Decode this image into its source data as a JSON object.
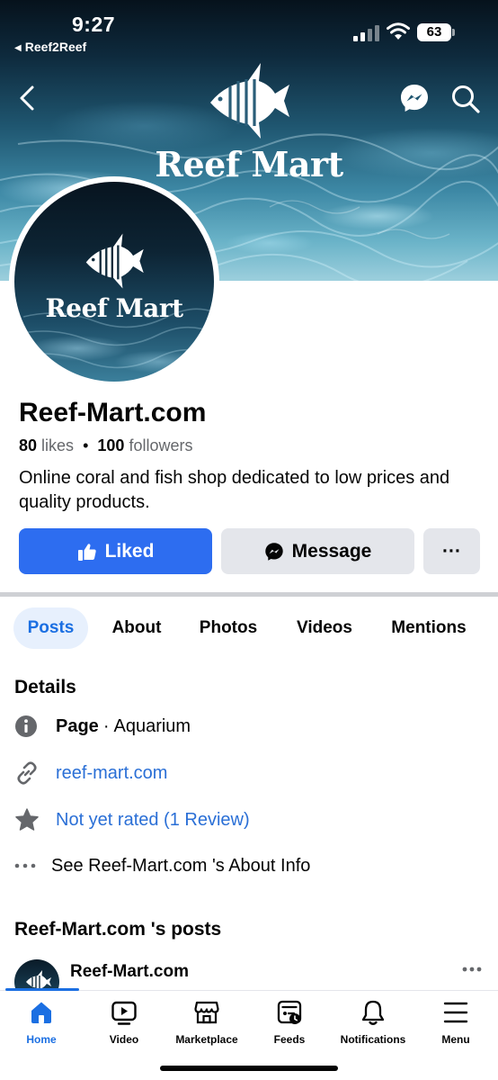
{
  "status_bar": {
    "time": "9:27",
    "back_app": "Reef2Reef",
    "battery": "63"
  },
  "cover": {
    "logo_text": "Reef Mart",
    "icons": [
      "back-arrow-icon",
      "messenger-icon",
      "search-icon"
    ]
  },
  "profile": {
    "logo_text": "Reef Mart",
    "name": "Reef-Mart.com",
    "likes_count": "80",
    "likes_label": "likes",
    "followers_count": "100",
    "followers_label": "followers",
    "bio": "Online coral and fish shop dedicated to low prices and quality products."
  },
  "actions": {
    "liked_label": "Liked",
    "message_label": "Message",
    "more_label": "···"
  },
  "tabs": [
    {
      "label": "Posts",
      "active": true
    },
    {
      "label": "About",
      "active": false
    },
    {
      "label": "Photos",
      "active": false
    },
    {
      "label": "Videos",
      "active": false
    },
    {
      "label": "Mentions",
      "active": false
    }
  ],
  "details": {
    "title": "Details",
    "category_prefix": "Page",
    "category_sep": "·",
    "category": "Aquarium",
    "website": "reef-mart.com",
    "rating": "Not yet rated (1 Review)",
    "about_link": "See Reef-Mart.com 's About Info"
  },
  "posts": {
    "title": "Reef-Mart.com 's posts",
    "author": "Reef-Mart.com"
  },
  "bottom_nav": [
    {
      "label": "Home",
      "icon": "home-icon",
      "active": true
    },
    {
      "label": "Video",
      "icon": "video-icon",
      "active": false
    },
    {
      "label": "Marketplace",
      "icon": "marketplace-icon",
      "active": false
    },
    {
      "label": "Feeds",
      "icon": "feeds-icon",
      "active": false
    },
    {
      "label": "Notifications",
      "icon": "bell-icon",
      "active": false
    },
    {
      "label": "Menu",
      "icon": "menu-icon",
      "active": false
    }
  ],
  "colors": {
    "accent": "#1b6fe2",
    "liked_button": "#2d6df0",
    "secondary_button": "#e4e6eb",
    "link": "#2a6fd6"
  }
}
